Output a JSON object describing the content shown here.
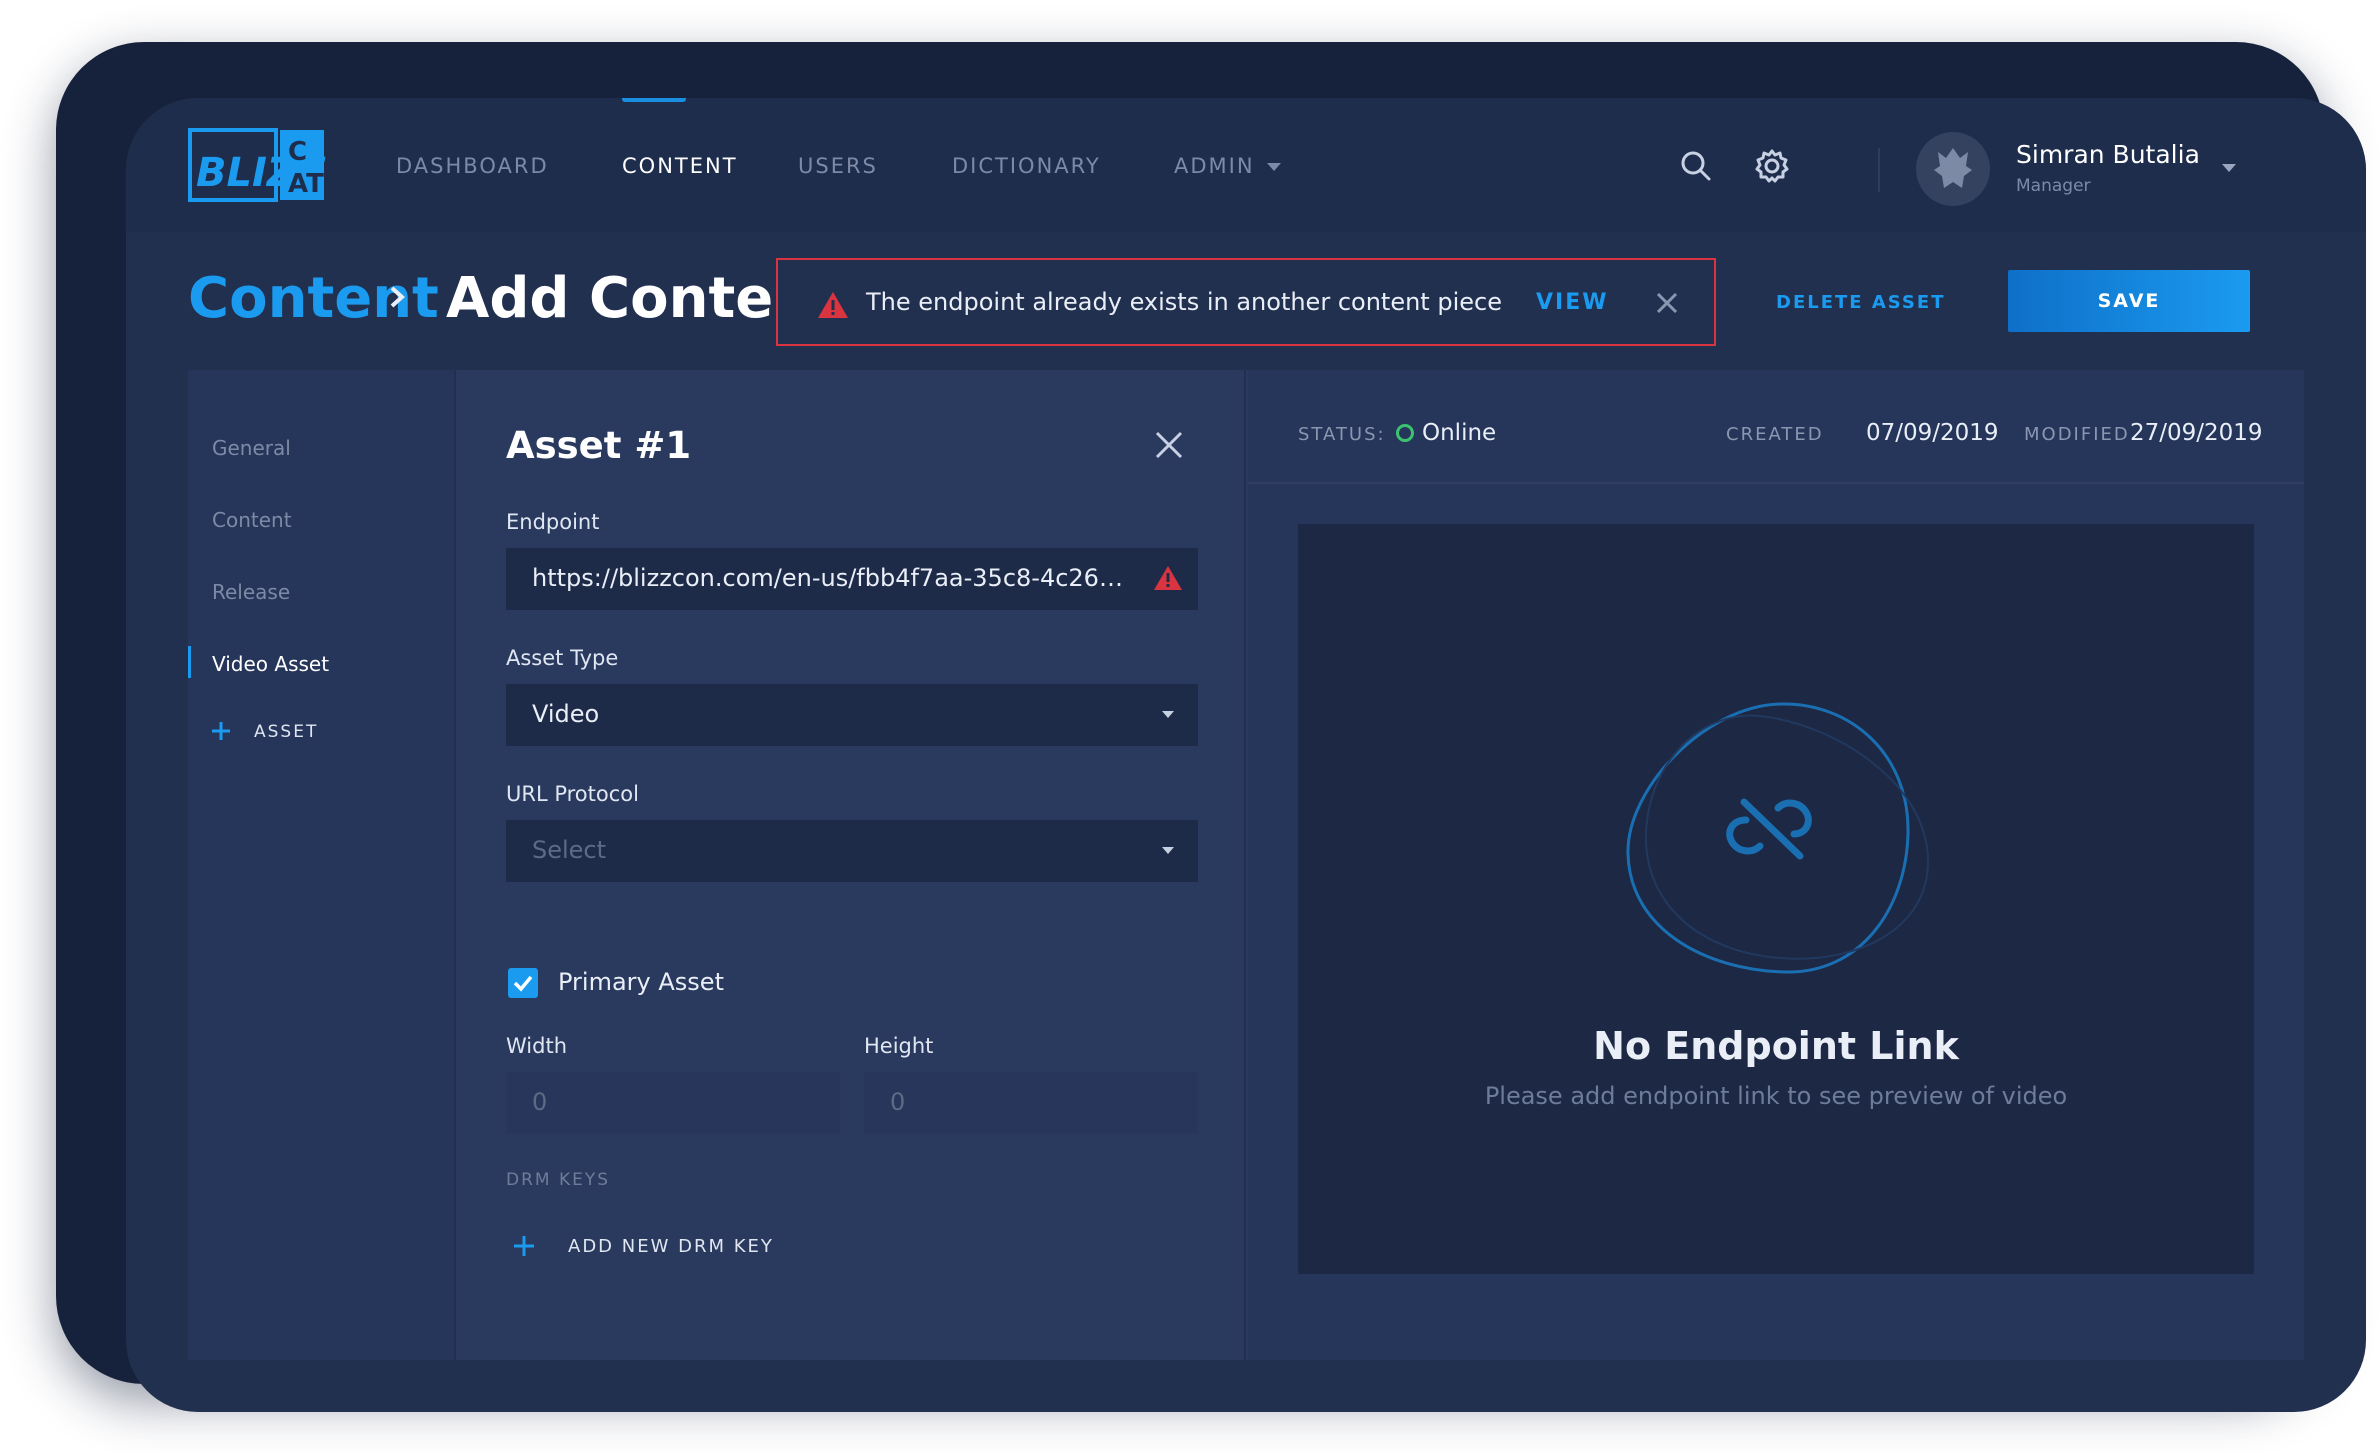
{
  "brand": {
    "logo_text": "BLIZZCAT"
  },
  "nav": {
    "items": [
      {
        "label": "DASHBOARD"
      },
      {
        "label": "CONTENT"
      },
      {
        "label": "USERS"
      },
      {
        "label": "DICTIONARY"
      },
      {
        "label": "ADMIN"
      }
    ],
    "active": "CONTENT"
  },
  "user": {
    "name": "Simran Butalia",
    "role": "Manager"
  },
  "breadcrumb": {
    "parent": "Content",
    "current": "Add Content"
  },
  "alert": {
    "message": "The endpoint already exists in another content piece",
    "action": "VIEW"
  },
  "actions": {
    "delete": "DELETE ASSET",
    "save": "SAVE"
  },
  "sidebar": {
    "items": [
      {
        "label": "General"
      },
      {
        "label": "Content"
      },
      {
        "label": "Release"
      },
      {
        "label": "Video Asset"
      }
    ],
    "active": "Video Asset",
    "add_label": "ASSET"
  },
  "form": {
    "title": "Asset #1",
    "endpoint_label": "Endpoint",
    "endpoint_value": "https://blizzcon.com/en-us/fbb4f7aa-35c8-4c26…",
    "asset_type_label": "Asset Type",
    "asset_type_value": "Video",
    "url_protocol_label": "URL Protocol",
    "url_protocol_placeholder": "Select",
    "primary_asset_label": "Primary Asset",
    "primary_asset_checked": true,
    "width_label": "Width",
    "width_placeholder": "0",
    "height_label": "Height",
    "height_placeholder": "0",
    "drm_section": "DRM KEYS",
    "drm_add": "ADD NEW DRM KEY"
  },
  "meta": {
    "status_label": "STATUS:",
    "status_value": "Online",
    "created_label": "CREATED",
    "created_value": "07/09/2019",
    "modified_label": "MODIFIED",
    "modified_value": "27/09/2019"
  },
  "preview": {
    "title": "No Endpoint Link",
    "subtitle": "Please add endpoint link to see preview of video"
  },
  "colors": {
    "accent": "#1a9bf0",
    "error": "#d9343f",
    "online": "#3cc36f",
    "background": "#223050"
  }
}
